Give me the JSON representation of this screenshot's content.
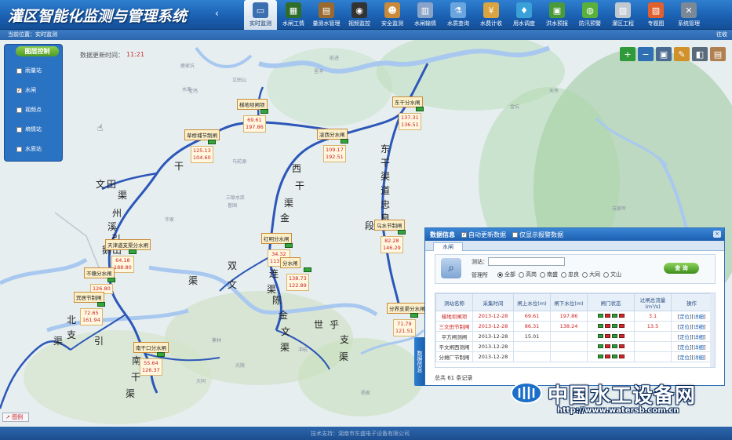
{
  "header": {
    "title": "灌区智能化监测与管理系统",
    "nav_prev": "‹",
    "nav": [
      {
        "label": "实时监测",
        "icon": "monitor-icon",
        "color": "#3c6fb0",
        "glyph": "▭",
        "active": true
      },
      {
        "label": "水闸工情",
        "icon": "sluice-icon",
        "color": "#2f6e2a",
        "glyph": "▦"
      },
      {
        "label": "量测水管理",
        "icon": "clipboard-icon",
        "color": "#9a6a2e",
        "glyph": "▤"
      },
      {
        "label": "视频监控",
        "icon": "camera-icon",
        "color": "#333333",
        "glyph": "◉"
      },
      {
        "label": "安全监测",
        "icon": "worker-icon",
        "color": "#c98a3a",
        "glyph": "☻"
      },
      {
        "label": "水闸输情",
        "icon": "document-icon",
        "color": "#8aa3c8",
        "glyph": "▥"
      },
      {
        "label": "水质查询",
        "icon": "flask-icon",
        "color": "#6aa5e0",
        "glyph": "⚗"
      },
      {
        "label": "水费计收",
        "icon": "money-icon",
        "color": "#d9a441",
        "glyph": "¥"
      },
      {
        "label": "用水调度",
        "icon": "water-drop-icon",
        "color": "#3aa0d8",
        "glyph": "♦"
      },
      {
        "label": "洪水预报",
        "icon": "forecast-icon",
        "color": "#4a9a3a",
        "glyph": "▣"
      },
      {
        "label": "防汛预警",
        "icon": "warning-icon",
        "color": "#5ab03c",
        "glyph": "◍"
      },
      {
        "label": "灌区工程",
        "icon": "engineering-icon",
        "color": "#c0c8d0",
        "glyph": "▧"
      },
      {
        "label": "专题图",
        "icon": "map-theme-icon",
        "color": "#e06030",
        "glyph": "▨"
      },
      {
        "label": "系统管理",
        "icon": "tools-icon",
        "color": "#7a8898",
        "glyph": "✕"
      }
    ]
  },
  "breadcrumb": {
    "text": "当前位置：实时监测",
    "collapse": "往收"
  },
  "map": {
    "update_label": "数据更新时间：",
    "update_value": "11:21",
    "layers": {
      "title": "图层控制",
      "items": [
        {
          "label": "雨量站",
          "checked": false
        },
        {
          "label": "水闸",
          "checked": true
        },
        {
          "label": "视频点",
          "checked": false
        },
        {
          "label": "墒情站",
          "checked": false
        },
        {
          "label": "水质站",
          "checked": false
        }
      ]
    },
    "tools": [
      {
        "icon": "zoom-in-icon",
        "glyph": "+",
        "color": "#2f9a3a"
      },
      {
        "icon": "zoom-out-icon",
        "glyph": "−",
        "color": "#2f6fb5"
      },
      {
        "icon": "full-extent-icon",
        "glyph": "▣",
        "color": "#4a6a90"
      },
      {
        "icon": "pen-icon",
        "glyph": "✎",
        "color": "#d0902a"
      },
      {
        "icon": "layer-icon",
        "glyph": "◧",
        "color": "#5a6a7a"
      },
      {
        "icon": "print-icon",
        "glyph": "▤",
        "color": "#b08050"
      }
    ],
    "stations": [
      {
        "name": "梯地坝闸项",
        "v1": "69.61",
        "v2": "197.86"
      },
      {
        "name": "草桥埔节制闸",
        "v1": "125.13",
        "v2": "104.60"
      },
      {
        "name": "凌西分水闸",
        "v1": "109.17",
        "v2": "192.51"
      },
      {
        "name": "东干分水闸",
        "v1": "137.31",
        "v2": "136.51"
      },
      {
        "name": "天津道支渠分水闸",
        "v1": "64.18",
        "v2": "188.80"
      },
      {
        "name": "不赣分水闸",
        "v1": "",
        "v2": "126.80"
      },
      {
        "name": "宾居节制闸",
        "v1": "72.65",
        "v2": "161.94"
      },
      {
        "name": "红明分水闸",
        "v1": "34.32",
        "v2": "113.82"
      },
      {
        "name": "分水闸",
        "v1": "138.73",
        "v2": "122.89"
      },
      {
        "name": "乌水节制闸",
        "v1": "82.28",
        "v2": "146.29"
      },
      {
        "name": "分界支渠分水闸",
        "v1": "71.79",
        "v2": "121.51"
      },
      {
        "name": "南干口分水闸",
        "v1": "55.64",
        "v2": "126.37"
      }
    ],
    "canal_chars": [
      "干",
      "渠",
      "文",
      "田",
      "州",
      "溪",
      "引",
      "鹅",
      "山",
      "东",
      "干",
      "渠",
      "道",
      "忠",
      "良",
      "段",
      "西",
      "干",
      "渠",
      "金",
      "东",
      "连",
      "渠",
      "陈",
      "金",
      "文",
      "渠",
      "世",
      "乎",
      "支",
      "渠",
      "文",
      "渠",
      "双",
      "南",
      "干",
      "渠",
      "支",
      "北",
      "渠",
      "引"
    ],
    "places": [
      "鹿家坑",
      "立田山",
      "水库",
      "马前源",
      "三联水库",
      "普国",
      "华家",
      "宝鸡",
      "前进",
      "里冲",
      "冲杭",
      "蕉林",
      "光陵",
      "大同",
      "上坪",
      "新村",
      "白鹤",
      "苏家坪",
      "周田",
      "赞坑",
      "金坑",
      "天亭",
      "山口",
      "杨家"
    ],
    "legend_btn": "图例"
  },
  "data_panel": {
    "title": "数据信息",
    "auto_update_label": "自动更新数据",
    "auto_update_checked": true,
    "alarm_only_label": "仅显示报警数据",
    "alarm_only_checked": false,
    "close": "×",
    "tab": "水闸",
    "side_tab": "数据信息",
    "search": {
      "station_label": "测站：",
      "station_placeholder": "",
      "org_label": "管理所",
      "options": [
        {
          "label": "全部",
          "selected": true
        },
        {
          "label": "高岗",
          "selected": false
        },
        {
          "label": "南盛",
          "selected": false
        },
        {
          "label": "忠良",
          "selected": false
        },
        {
          "label": "大同",
          "selected": false
        },
        {
          "label": "文山",
          "selected": false
        }
      ],
      "query_btn": "查 询"
    },
    "columns": [
      "测站名称",
      "采集时间",
      "闸上水位(m)",
      "闸下水位(m)",
      "闸门状态",
      "过闸总流量(m³/s)",
      "操作"
    ],
    "rows": [
      {
        "name": "梯地坝闸项",
        "time": "2013-12-28",
        "up": "69.61",
        "down": "197.86",
        "flow": "3.1",
        "red": true,
        "ops": [
          "定位",
          "详细"
        ]
      },
      {
        "name": "三文田节制闸",
        "time": "2013-12-28",
        "up": "86.31",
        "down": "138.24",
        "flow": "13.5",
        "red": true,
        "ops": [
          "定位",
          "详细"
        ]
      },
      {
        "name": "平方闸测闸",
        "time": "2013-12-28",
        "up": "15.01",
        "down": "",
        "flow": "",
        "red": false,
        "ops": [
          "定位",
          "详细"
        ]
      },
      {
        "name": "平文闸西测闸",
        "time": "2013-12-28",
        "up": "",
        "down": "",
        "flow": "",
        "red": false,
        "ops": [
          "定位",
          "详细"
        ]
      },
      {
        "name": "分摊厂节制闸",
        "time": "2013-12-28",
        "up": "",
        "down": "",
        "flow": "",
        "red": false,
        "ops": [
          "定位",
          "详细"
        ]
      }
    ],
    "total": "总共 61 条记录"
  },
  "footer": {
    "text": "技术支持：湖南市东盛电子设备有限公司"
  },
  "watermark": {
    "text": "中国水工设备网",
    "url": "http://www.watersb.com.cn"
  }
}
